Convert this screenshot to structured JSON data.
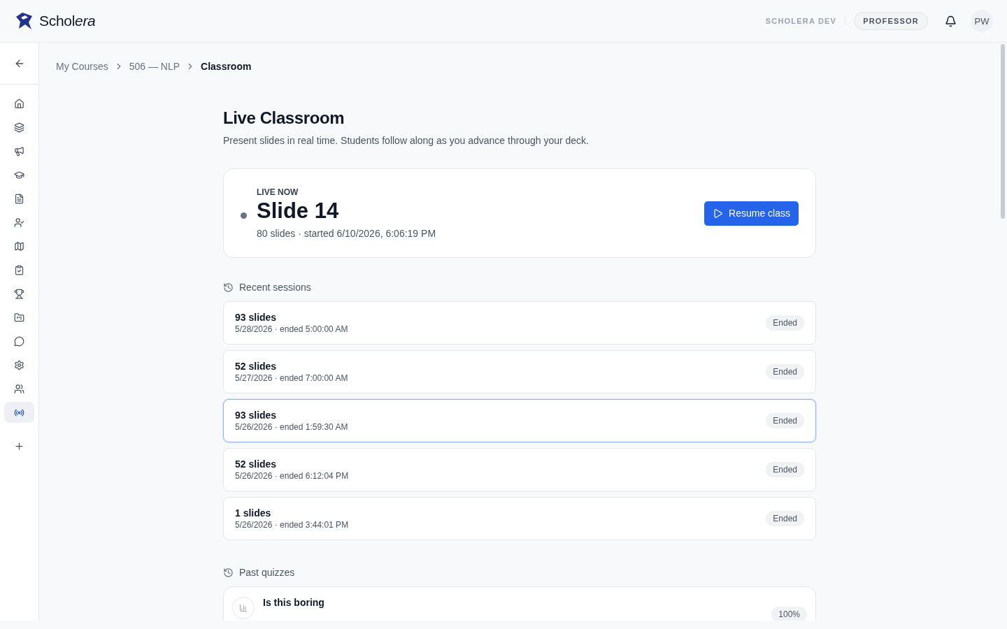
{
  "header": {
    "brand": {
      "plain": "Schol",
      "italic": "era"
    },
    "environment": "SCHOLERA DEV",
    "role": "PROFESSOR",
    "avatar": "PW"
  },
  "sidebar": {
    "items": [
      {
        "selected": false
      },
      {
        "selected": false
      },
      {
        "selected": false
      },
      {
        "selected": false
      },
      {
        "selected": false
      },
      {
        "selected": false
      },
      {
        "selected": false
      },
      {
        "selected": false
      },
      {
        "selected": false
      },
      {
        "selected": false
      },
      {
        "selected": false
      },
      {
        "selected": false
      },
      {
        "selected": false
      },
      {
        "selected": true
      },
      {
        "selected": false
      }
    ]
  },
  "breadcrumbs": [
    {
      "label": "My Courses",
      "current": false
    },
    {
      "label": "506 — NLP",
      "current": false
    },
    {
      "label": "Classroom",
      "current": true
    }
  ],
  "page": {
    "title": "Live Classroom",
    "subtitle": "Present slides in real time. Students follow along as you advance through your deck."
  },
  "live": {
    "label": "LIVE NOW",
    "slide": "Slide 14",
    "meta": "80 slides · started 6/10/2026, 6:06:19 PM",
    "button": "Resume class"
  },
  "recent_sessions": {
    "title": "Recent sessions",
    "items": [
      {
        "title": "93 slides",
        "meta": "5/28/2026 · ended 5:00:00 AM",
        "status": "Ended",
        "selected": false
      },
      {
        "title": "52 slides",
        "meta": "5/27/2026 · ended 7:00:00 AM",
        "status": "Ended",
        "selected": false
      },
      {
        "title": "93 slides",
        "meta": "5/26/2026 · ended 1:59:30 AM",
        "status": "Ended",
        "selected": true
      },
      {
        "title": "52 slides",
        "meta": "5/26/2026 · ended 6:12:04 PM",
        "status": "Ended",
        "selected": false
      },
      {
        "title": "1 slides",
        "meta": "5/26/2026 · ended 3:44:01 PM",
        "status": "Ended",
        "selected": false
      }
    ]
  },
  "past_quizzes": {
    "title": "Past quizzes",
    "items": [
      {
        "title": "Is this boring",
        "score": "100%"
      }
    ]
  }
}
